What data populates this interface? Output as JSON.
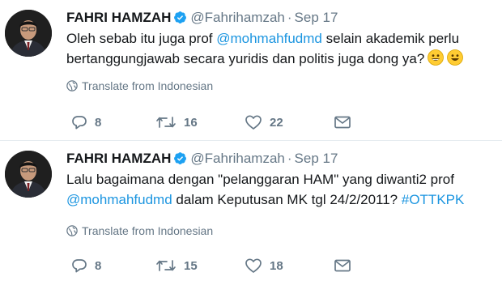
{
  "tweets": [
    {
      "author": {
        "name": "FAHRI HAMZAH",
        "handle": "@Fahrihamzah"
      },
      "separator": "·",
      "date": "Sep 17",
      "text": {
        "l1_a": "Oleh sebab itu juga prof ",
        "l1_link": "@mohmahfudmd",
        "l1_b": " selain akademik perlu",
        "l2": "bertanggungjawab secara yuridis dan politis juga dong ya?"
      },
      "emoji": [
        "grinning-face-emoji",
        "grinning-face-emoji"
      ],
      "translate": "Translate from Indonesian",
      "actions": {
        "replies": "8",
        "retweets": "16",
        "likes": "22"
      }
    },
    {
      "author": {
        "name": "FAHRI HAMZAH",
        "handle": "@Fahrihamzah"
      },
      "separator": "·",
      "date": "Sep 17",
      "text": {
        "l1": "Lalu bagaimana dengan \"pelanggaran HAM\" yang diwanti2 prof",
        "l2_link": "@mohmahfudmd",
        "l2_b": " dalam Keputusan MK tgl 24/2/2011? ",
        "l2_tag": "#OTTKPK"
      },
      "translate": "Translate from Indonesian",
      "actions": {
        "replies": "8",
        "retweets": "15",
        "likes": "18"
      }
    }
  ],
  "icons": [
    "verified-badge-icon",
    "globe-icon",
    "reply-icon",
    "retweet-icon",
    "like-heart-icon",
    "direct-message-icon"
  ],
  "colors": {
    "link": "#1b95e0",
    "muted": "#657786",
    "text": "#14171a",
    "verified": "#1da1f2",
    "divider": "#e6ecf0"
  }
}
